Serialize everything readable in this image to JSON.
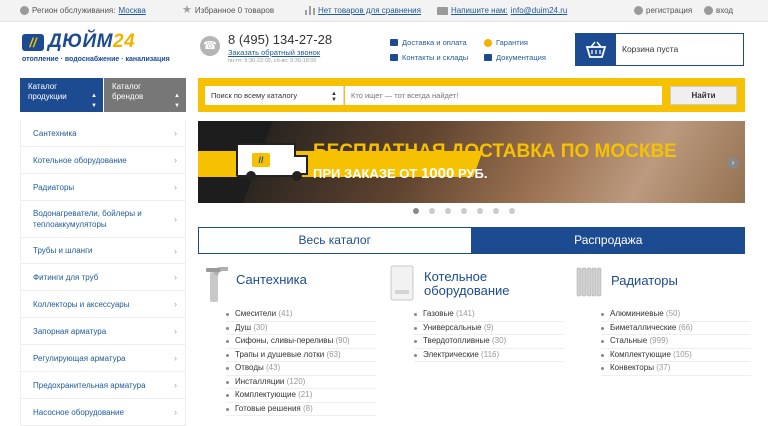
{
  "topbar": {
    "region_label": "Регион обслуживания:",
    "region_value": "Москва",
    "favorites": "Избранное 0 товаров",
    "compare": "Нет товаров для сравнения",
    "write_label": "Напишите нам:",
    "email": "info@duim24.ru",
    "register": "регистрация",
    "login": "вход"
  },
  "header": {
    "logo_mark": "//",
    "logo_main": "ДЮЙМ",
    "logo_num": "24",
    "logo_tagline": "отопление · водоснабжение · канализация",
    "phone": "8 (495) 134-27-28",
    "callback": "Заказать обратный звонок",
    "hours": "пн-пт: 9:30-22:00, сб-вс: 9:30-18:00",
    "links": [
      "Доставка и оплата",
      "Контакты и склады",
      "Гарантия",
      "Документация"
    ],
    "cart": "Корзина пуста"
  },
  "nav": {
    "catalog": "Каталог продукции",
    "brands": "Каталог брендов",
    "search_scope": "Поиск по всему каталогу",
    "search_placeholder": "Кто ищет — тот всегда найдет!",
    "search_button": "Найти"
  },
  "sidebar": {
    "items": [
      "Сантехника",
      "Котельное оборудование",
      "Радиаторы",
      "Водонагреватели, бойлеры и теплоаккумуляторы",
      "Трубы и шланги",
      "Фитинги для труб",
      "Коллекторы и аксессуары",
      "Запорная арматура",
      "Регулирующая арматура",
      "Предохранительная арматура",
      "Насосное оборудование"
    ]
  },
  "banner": {
    "line1": "БЕСПЛАТНАЯ ДОСТАВКА ПО МОСКВЕ",
    "line2_prefix": "ПРИ ЗАКАЗЕ ОТ",
    "line2_amount": "1000",
    "line2_suffix": "РУБ."
  },
  "tabs": {
    "all": "Весь каталог",
    "sale": "Распродажа"
  },
  "categories": [
    {
      "title": "Сантехника",
      "items": [
        {
          "name": "Смесители",
          "count": "(41)"
        },
        {
          "name": "Душ",
          "count": "(30)"
        },
        {
          "name": "Сифоны, сливы-переливы",
          "count": "(90)"
        },
        {
          "name": "Трапы и душевые лотки",
          "count": "(63)"
        },
        {
          "name": "Отводы",
          "count": "(43)"
        },
        {
          "name": "Инсталляции",
          "count": "(120)"
        },
        {
          "name": "Комплектующие",
          "count": "(21)"
        },
        {
          "name": "Готовые решения",
          "count": "(8)"
        }
      ]
    },
    {
      "title": "Котельное оборудование",
      "items": [
        {
          "name": "Газовые",
          "count": "(141)"
        },
        {
          "name": "Универсальные",
          "count": "(9)"
        },
        {
          "name": "Твердотопливные",
          "count": "(30)"
        },
        {
          "name": "Электрические",
          "count": "(116)"
        }
      ]
    },
    {
      "title": "Радиаторы",
      "items": [
        {
          "name": "Алюминиевые",
          "count": "(50)"
        },
        {
          "name": "Биметаллические",
          "count": "(66)"
        },
        {
          "name": "Стальные",
          "count": "(999)"
        },
        {
          "name": "Комплектующие",
          "count": "(105)"
        },
        {
          "name": "Конвекторы",
          "count": "(37)"
        }
      ]
    }
  ]
}
